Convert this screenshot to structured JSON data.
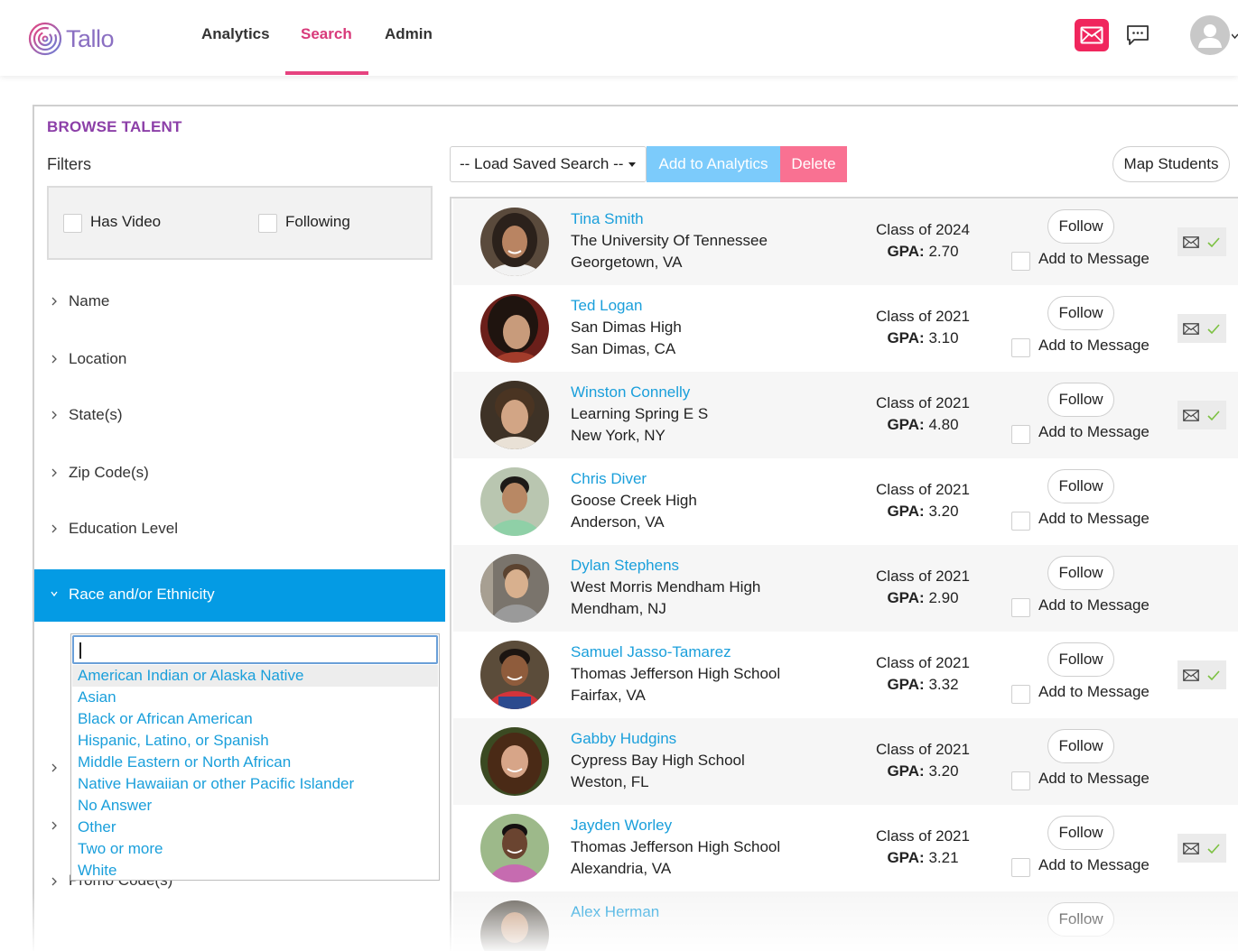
{
  "app": {
    "logo_text": "Tallo"
  },
  "nav": {
    "items": [
      {
        "label": "Analytics",
        "active": false
      },
      {
        "label": "Search",
        "active": true
      },
      {
        "label": "Admin",
        "active": false
      }
    ]
  },
  "colors": {
    "accent_pink": "#e6437f",
    "brand_blue": "#049be4",
    "link_blue": "#1a9fdb",
    "title_purple": "#8c3fa8",
    "mail_red": "#f0265d"
  },
  "browse": {
    "title": "BROWSE TALENT",
    "filters_label": "Filters",
    "checkboxes": [
      {
        "label": "Has Video",
        "checked": false
      },
      {
        "label": "Following",
        "checked": false
      }
    ],
    "accordion": [
      {
        "label": "Name",
        "open": false
      },
      {
        "label": "Location",
        "open": false
      },
      {
        "label": "State(s)",
        "open": false
      },
      {
        "label": "Zip Code(s)",
        "open": false
      },
      {
        "label": "Education Level",
        "open": false
      },
      {
        "label": "Race and/or Ethnicity",
        "open": true
      }
    ],
    "promo_label": "Promo Code(s)",
    "ethnicity_search_value": "",
    "ethnicity_options": [
      "American Indian or Alaska Native",
      "Asian",
      "Black or African American",
      "Hispanic, Latino, or Spanish",
      "Middle Eastern or North African",
      "Native Hawaiian or other Pacific Islander",
      "No Answer",
      "Other",
      "Two or more",
      "White"
    ]
  },
  "toolbar": {
    "saved_search": "-- Load Saved Search --",
    "add_to_analytics": "Add to Analytics",
    "delete": "Delete",
    "map_students": "Map Students"
  },
  "students": [
    {
      "name": "Tina Smith",
      "school": "The University Of Tennessee",
      "location": "Georgetown, VA",
      "class_of": "Class of 2024",
      "gpa_label": "GPA:",
      "gpa": "2.70",
      "follow_label": "Follow",
      "add_label": "Add to Message",
      "messaged": true
    },
    {
      "name": "Ted Logan",
      "school": "San Dimas High",
      "location": "San Dimas, CA",
      "class_of": "Class of 2021",
      "gpa_label": "GPA:",
      "gpa": "3.10",
      "follow_label": "Follow",
      "add_label": "Add to Message",
      "messaged": true
    },
    {
      "name": "Winston Connelly",
      "school": "Learning Spring E S",
      "location": "New York, NY",
      "class_of": "Class of 2021",
      "gpa_label": "GPA:",
      "gpa": "4.80",
      "follow_label": "Follow",
      "add_label": "Add to Message",
      "messaged": true
    },
    {
      "name": "Chris Diver",
      "school": "Goose Creek High",
      "location": "Anderson, VA",
      "class_of": "Class of 2021",
      "gpa_label": "GPA:",
      "gpa": "3.20",
      "follow_label": "Follow",
      "add_label": "Add to Message",
      "messaged": false
    },
    {
      "name": "Dylan Stephens",
      "school": "West Morris Mendham High",
      "location": "Mendham, NJ",
      "class_of": "Class of 2021",
      "gpa_label": "GPA:",
      "gpa": "2.90",
      "follow_label": "Follow",
      "add_label": "Add to Message",
      "messaged": false
    },
    {
      "name": "Samuel Jasso-Tamarez",
      "school": "Thomas Jefferson High School",
      "location": "Fairfax, VA",
      "class_of": "Class of 2021",
      "gpa_label": "GPA:",
      "gpa": "3.32",
      "follow_label": "Follow",
      "add_label": "Add to Message",
      "messaged": true
    },
    {
      "name": "Gabby Hudgins",
      "school": "Cypress Bay High School",
      "location": "Weston, FL",
      "class_of": "Class of 2021",
      "gpa_label": "GPA:",
      "gpa": "3.20",
      "follow_label": "Follow",
      "add_label": "Add to Message",
      "messaged": false
    },
    {
      "name": "Jayden Worley",
      "school": "Thomas Jefferson High School",
      "location": "Alexandria, VA",
      "class_of": "Class of 2021",
      "gpa_label": "GPA:",
      "gpa": "3.21",
      "follow_label": "Follow",
      "add_label": "Add to Message",
      "messaged": true
    },
    {
      "name": "Alex Herman",
      "school": "",
      "location": "",
      "class_of": "",
      "gpa_label": "",
      "gpa": "",
      "follow_label": "Follow",
      "add_label": "",
      "messaged": false
    }
  ]
}
